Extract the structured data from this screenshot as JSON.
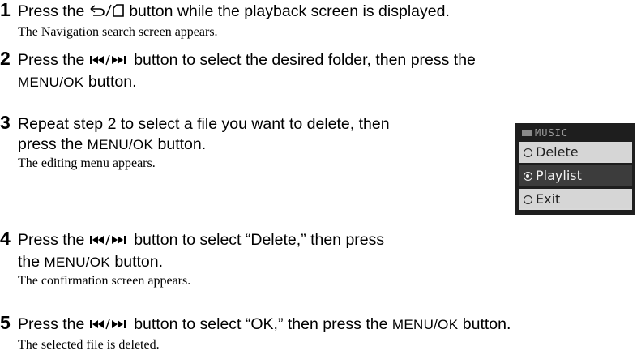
{
  "steps": [
    {
      "number": "1",
      "lines": [
        {
          "pre": "Press the ",
          "icon": "back-home-button-icon",
          "post": " button while the playback screen is displayed."
        }
      ],
      "note": "The Navigation search screen appears."
    },
    {
      "number": "2",
      "line1_pre": "Press the ",
      "icon": "skip-buttons-icon",
      "line1_post": " button to select the desired folder, then press the",
      "line2_key": "MENU/OK",
      "line2_post": " button."
    },
    {
      "number": "3",
      "line1": "Repeat step 2 to select a file you want to delete, then",
      "line2_pre": "press the ",
      "line2_key": "MENU/OK",
      "line2_post": " button.",
      "note": "The editing menu appears."
    },
    {
      "number": "4",
      "line1_pre": "Press the ",
      "icon": "skip-buttons-icon",
      "line1_post": " button to select “Delete,” then press",
      "line2_pre": "the ",
      "line2_key": "MENU/OK",
      "line2_post": " button.",
      "note": "The confirmation screen appears."
    },
    {
      "number": "5",
      "line1_pre": "Press the ",
      "icon": "skip-buttons-icon",
      "line1_mid": " button to select “OK,” then press the ",
      "line1_key": "MENU/OK",
      "line1_post": " button.",
      "note": "The selected file is deleted."
    }
  ],
  "device_menu": {
    "title": "MUSIC",
    "items": [
      {
        "label": "Delete",
        "selected": false
      },
      {
        "label": "Playlist",
        "selected": true
      },
      {
        "label": "Exit",
        "selected": false
      }
    ]
  }
}
